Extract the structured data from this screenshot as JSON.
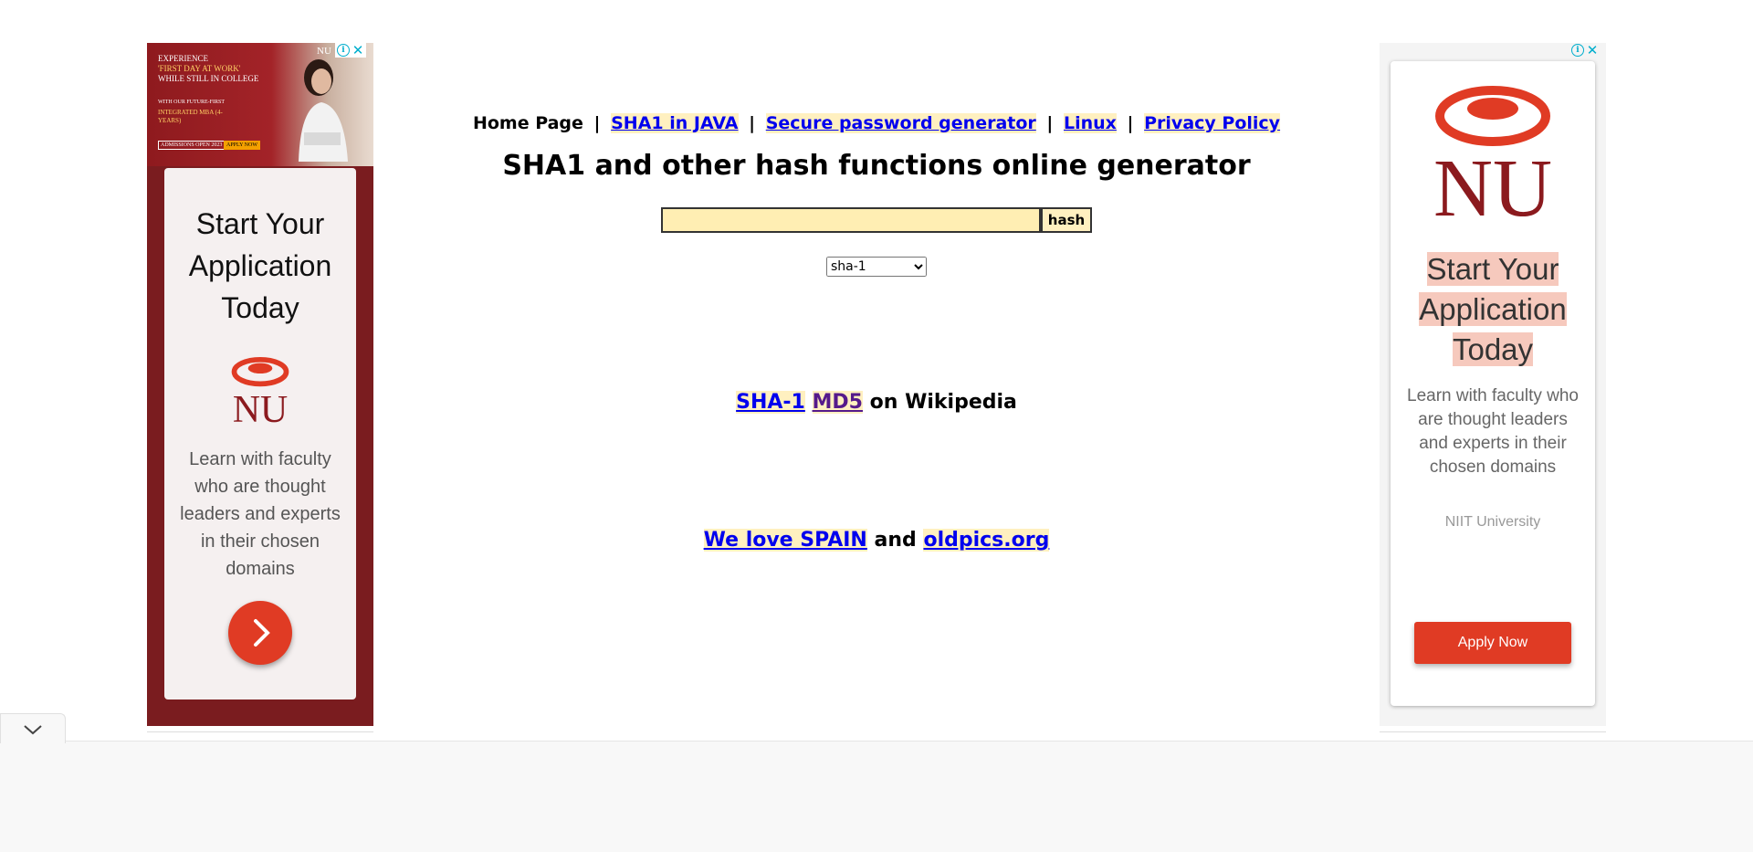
{
  "nav": {
    "home": "Home Page",
    "sep": "|",
    "links": [
      {
        "label": "SHA1 in JAVA"
      },
      {
        "label": "Secure password generator"
      },
      {
        "label": "Linux"
      },
      {
        "label": "Privacy Policy"
      }
    ]
  },
  "title": "SHA1 and other hash functions online generator",
  "form": {
    "input_value": "",
    "button_label": "hash",
    "algorithm_selected": "sha-1"
  },
  "wiki": {
    "sha1": "SHA-1",
    "md5": "MD5",
    "suffix": "on Wikipedia"
  },
  "love": {
    "spain": "We love SPAIN",
    "and": "and",
    "oldpics": "oldpics.org"
  },
  "ad_left": {
    "banner_line1": "EXPERIENCE",
    "banner_line2": "'FIRST DAY AT WORK'",
    "banner_line3": "WHILE STILL IN COLLEGE",
    "banner_line4": "WITH OUR FUTURE-FIRST",
    "banner_line5": "INTEGRATED MBA (4-YEARS)",
    "banner_badge": "ADMISSIONS OPEN 2023",
    "banner_apply": "APPLY NOW",
    "banner_logo": "NU",
    "headline": "Start Your Application Today",
    "body": "Learn with faculty who are thought leaders and experts in their chosen domains"
  },
  "ad_right": {
    "headline_1": "Start Your",
    "headline_2": "Application",
    "headline_3": "Today",
    "body": "Learn with faculty who are thought leaders and experts in their chosen domains",
    "brand": "NIIT University",
    "cta": "Apply Now"
  },
  "colors": {
    "link": "#0000ee",
    "link_visited": "#551a8b",
    "highlight": "#fff0c0",
    "input_bg": "#ffeeb3",
    "ad_red": "#e03b24",
    "ad_maroon": "#7a1c1f",
    "adchoices": "#00aecd"
  },
  "icons": {
    "adchoices": "info-icon",
    "close": "close-icon",
    "next": "chevron-right-icon",
    "collapse": "chevron-down-icon"
  }
}
